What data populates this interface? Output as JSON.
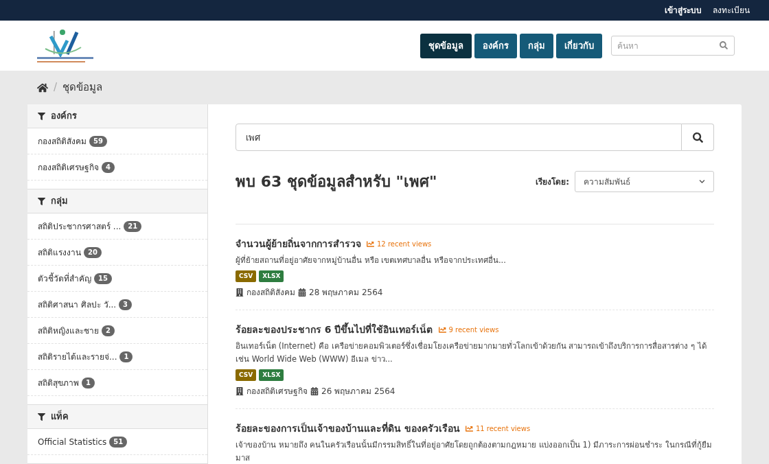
{
  "account_links": [
    {
      "label": "เข้าสู่ระบบ",
      "bold": true
    },
    {
      "label": "ลงทะเบียน",
      "bold": false
    }
  ],
  "nav": [
    {
      "label": "ชุดข้อมูล",
      "selected": true
    },
    {
      "label": "องค์กร",
      "selected": false
    },
    {
      "label": "กลุ่ม",
      "selected": false
    },
    {
      "label": "เกี่ยวกับ",
      "selected": false
    }
  ],
  "header_search": {
    "placeholder": "ค้นหา"
  },
  "breadcrumb_separator": "/",
  "breadcrumb": [
    "ชุดข้อมูล"
  ],
  "facets": [
    {
      "title": "องค์กร",
      "items": [
        {
          "label": "กองสถิติสังคม",
          "count": "59"
        },
        {
          "label": "กองสถิติเศรษฐกิจ",
          "count": "4"
        }
      ]
    },
    {
      "title": "กลุ่ม",
      "items": [
        {
          "label": "สถิติประชากรศาสตร์ ...",
          "count": "21"
        },
        {
          "label": "สถิติแรงงาน",
          "count": "20"
        },
        {
          "label": "ตัวชี้วัดที่สำคัญ",
          "count": "15"
        },
        {
          "label": "สถิติศาสนา ศิลปะ วั...",
          "count": "3"
        },
        {
          "label": "สถิติหญิงและชาย",
          "count": "2"
        },
        {
          "label": "สถิติรายได้และรายจ่...",
          "count": "1"
        },
        {
          "label": "สถิติสุขภาพ",
          "count": "1"
        }
      ]
    },
    {
      "title": "แท็ค",
      "items": [
        {
          "label": "Official Statistics",
          "count": "51"
        }
      ]
    }
  ],
  "search": {
    "value": "เพศ"
  },
  "result_heading": "พบ 63 ชุดข้อมูลสำหรับ \"เพศ\"",
  "sort": {
    "label": "เรียงโดย:",
    "value": "ความสัมพันธ์"
  },
  "datasets": [
    {
      "title": "จำนวนผู้ย้ายถิ่นจากการสำรวจ",
      "views": "12 recent views",
      "description": "ผู้ที่ย้ายสถานที่อยู่อาศัยจากหมู่บ้านอื่น หรือ เขตเทศบาลอื่น หรือจากประเทศอื่น...",
      "formats": [
        {
          "label": "CSV",
          "color": "#8a6a00"
        },
        {
          "label": "XLSX",
          "color": "#2e7d40"
        }
      ],
      "organization": "กองสถิติสังคม",
      "date": "28 พฤษภาคม 2564"
    },
    {
      "title": "ร้อยละของประชากร 6 ปีขึ้นไปที่ใช้อินเทอร์เน็ต",
      "views": "9 recent views",
      "description": "อินเทอร์เน็ต (Internet) คือ เครือข่ายคอมพิวเตอร์ซึ่งเชื่อมโยงเครือข่ายมากมายทั่วโลกเข้าด้วยกัน สามารถเข้าถึงบริการการสื่อสารต่าง ๆ ได้ เช่น World Wide Web (WWW) อีเมล ข่าว...",
      "formats": [
        {
          "label": "CSV",
          "color": "#8a6a00"
        },
        {
          "label": "XLSX",
          "color": "#2e7d40"
        }
      ],
      "organization": "กองสถิติเศรษฐกิจ",
      "date": "26 พฤษภาคม 2564"
    },
    {
      "title": "ร้อยละของการเป็นเจ้าของบ้านและที่ดิน ของครัวเรือน",
      "views": "11 recent views",
      "description": "เจ้าของบ้าน หมายถึง คนในครัวเรือนนั้นมีกรรมสิทธิ์ในที่อยู่อาศัยโดยถูกต้องตามกฎหมาย แบ่งออกเป็น 1) มีภาระการผ่อนชำระ ในกรณีที่กู้ยืมมาส"
    }
  ]
}
